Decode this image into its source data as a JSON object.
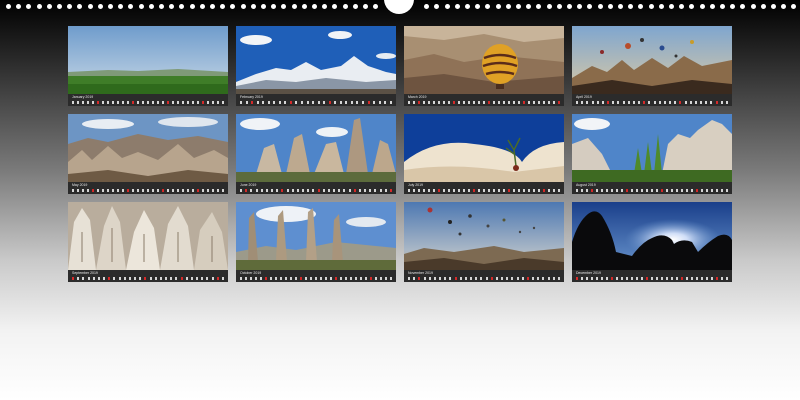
{
  "calendar": {
    "months": [
      {
        "name": "January 2019",
        "scene": "green-plain-sky"
      },
      {
        "name": "February 2019",
        "scene": "snowy-mountains"
      },
      {
        "name": "March 2019",
        "scene": "hot-air-balloon-valley"
      },
      {
        "name": "April 2019",
        "scene": "balloons-over-rocks"
      },
      {
        "name": "May 2019",
        "scene": "rocky-valley-panorama"
      },
      {
        "name": "June 2019",
        "scene": "rock-formations-clouds"
      },
      {
        "name": "July 2019",
        "scene": "white-rock-tree"
      },
      {
        "name": "August 2019",
        "scene": "tuff-cliffs-poplars"
      },
      {
        "name": "September 2019",
        "scene": "white-tuff-cones"
      },
      {
        "name": "October 2019",
        "scene": "fairy-chimneys"
      },
      {
        "name": "November 2019",
        "scene": "balloons-over-town"
      },
      {
        "name": "December 2019",
        "scene": "silhouette-sunburst"
      }
    ],
    "colors": {
      "sunday": "#d42a2a",
      "weekday": "#d6d6d6",
      "strip": "#2b2b2b"
    }
  }
}
